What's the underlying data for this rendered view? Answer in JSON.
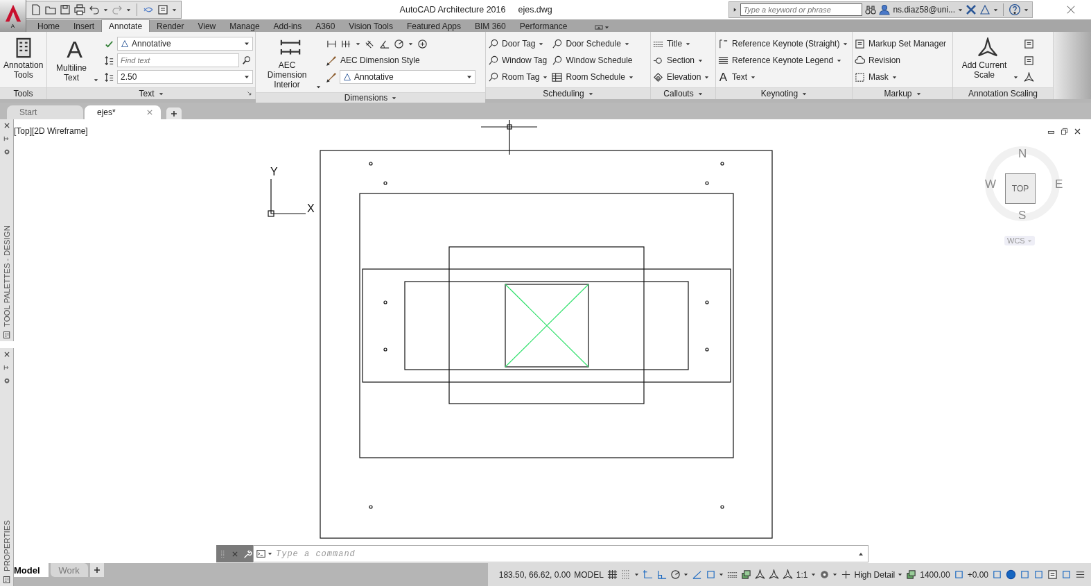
{
  "title_bar": {
    "app_letter": "A",
    "title": "AutoCAD Architecture 2016",
    "file": "ejes.dwg",
    "search_placeholder": "Type a keyword or phrase",
    "user": "ns.diaz58@uni..."
  },
  "ribbon_tabs": [
    {
      "label": "Home",
      "selected": false
    },
    {
      "label": "Insert",
      "selected": false
    },
    {
      "label": "Annotate",
      "selected": true
    },
    {
      "label": "Render",
      "selected": false
    },
    {
      "label": "View",
      "selected": false
    },
    {
      "label": "Manage",
      "selected": false
    },
    {
      "label": "Add-ins",
      "selected": false
    },
    {
      "label": "A360",
      "selected": false
    },
    {
      "label": "Vision Tools",
      "selected": false
    },
    {
      "label": "Featured Apps",
      "selected": false
    },
    {
      "label": "BIM 360",
      "selected": false
    },
    {
      "label": "Performance",
      "selected": false
    }
  ],
  "ribbon_panels": [
    {
      "title": "Tools",
      "menu": false,
      "launcher": false,
      "columns": [
        [
          {
            "kind": "large",
            "label": "Annotation Tools",
            "dropdown": false
          }
        ]
      ]
    },
    {
      "title": "Text",
      "menu": true,
      "launcher": true,
      "columns": [
        [
          {
            "kind": "large",
            "label": "Multiline Text",
            "glyph": "A",
            "dropdown": true
          }
        ],
        [
          {
            "kind": "style-combo",
            "value": "Annotative"
          },
          {
            "kind": "field",
            "placeholder": "Find text"
          },
          {
            "kind": "combo",
            "value": "2.50"
          }
        ]
      ]
    },
    {
      "title": "Dimensions",
      "menu": true,
      "launcher": false,
      "columns": [
        [
          {
            "kind": "large",
            "label": "AEC Dimension Interior",
            "dropdown": true
          }
        ],
        [
          {
            "kind": "toolrow"
          },
          {
            "kind": "small",
            "label": "AEC Dimension Style",
            "dropdown": false
          },
          {
            "kind": "style-combo",
            "value": "Annotative"
          }
        ]
      ]
    },
    {
      "title": "Scheduling",
      "menu": true,
      "launcher": false,
      "columns": [
        [
          {
            "kind": "small",
            "label": "Door Tag",
            "dropdown": true
          },
          {
            "kind": "small",
            "label": "Window Tag",
            "dropdown": false
          },
          {
            "kind": "small",
            "label": "Room Tag",
            "dropdown": true
          }
        ],
        [
          {
            "kind": "small",
            "label": "Door Schedule",
            "dropdown": true
          },
          {
            "kind": "small",
            "label": "Window Schedule",
            "dropdown": false
          },
          {
            "kind": "small",
            "label": "Room Schedule",
            "dropdown": true
          }
        ]
      ]
    },
    {
      "title": "Callouts",
      "menu": true,
      "launcher": false,
      "columns": [
        [
          {
            "kind": "small",
            "label": "Title",
            "dropdown": true
          },
          {
            "kind": "small",
            "label": "Section",
            "dropdown": true
          },
          {
            "kind": "small",
            "label": "Elevation",
            "dropdown": true
          }
        ]
      ]
    },
    {
      "title": "Keynoting",
      "menu": true,
      "launcher": false,
      "columns": [
        [
          {
            "kind": "small",
            "label": "Reference Keynote (Straight)",
            "dropdown": true
          },
          {
            "kind": "small",
            "label": "Reference Keynote Legend",
            "dropdown": true
          },
          {
            "kind": "small",
            "label": "Text",
            "glyph": "A",
            "dropdown": true
          }
        ]
      ]
    },
    {
      "title": "Markup",
      "menu": true,
      "launcher": false,
      "columns": [
        [
          {
            "kind": "small",
            "label": "Markup Set Manager",
            "dropdown": false
          },
          {
            "kind": "small",
            "label": "Revision",
            "dropdown": false
          },
          {
            "kind": "small",
            "label": "Mask",
            "dropdown": true
          }
        ]
      ]
    },
    {
      "title": "Annotation Scaling",
      "menu": false,
      "launcher": false,
      "columns": [
        [
          {
            "kind": "large",
            "label": "Add Current Scale",
            "dropdown": true
          }
        ],
        [
          {
            "kind": "iconbutton"
          },
          {
            "kind": "iconbutton"
          },
          {
            "kind": "iconbutton"
          }
        ]
      ]
    }
  ],
  "file_tabs": [
    {
      "label": "Start",
      "selected": false,
      "closable": false
    },
    {
      "label": "ejes*",
      "selected": true,
      "closable": true
    }
  ],
  "left_palettes": [
    {
      "label": "TOOL PALETTES - DESIGN"
    },
    {
      "label": "PROPERTIES"
    }
  ],
  "viewport": {
    "label": "[Top][2D Wireframe]",
    "axis_x": "X",
    "axis_y": "Y"
  },
  "viewcube": {
    "face": "TOP",
    "north": "N",
    "south": "S",
    "east": "E",
    "west": "W",
    "ucs": "WCS"
  },
  "command_line": {
    "placeholder": "Type a command"
  },
  "layout_tabs": [
    {
      "label": "Model",
      "selected": true
    },
    {
      "label": "Work",
      "selected": false
    }
  ],
  "status_items": [
    {
      "kind": "text",
      "label": "183.50, 66.62, 0.00",
      "dropdown": false
    },
    {
      "kind": "text",
      "label": "MODEL",
      "dropdown": false
    },
    {
      "kind": "icon",
      "dropdown": false
    },
    {
      "kind": "icon",
      "dropdown": true
    },
    {
      "kind": "icon",
      "dropdown": false
    },
    {
      "kind": "icon",
      "dropdown": false
    },
    {
      "kind": "icon",
      "dropdown": true
    },
    {
      "kind": "icon",
      "dropdown": false
    },
    {
      "kind": "icon",
      "dropdown": true
    },
    {
      "kind": "icon",
      "dropdown": false
    },
    {
      "kind": "icon",
      "dropdown": false
    },
    {
      "kind": "icon",
      "dropdown": false
    },
    {
      "kind": "icon",
      "dropdown": false
    },
    {
      "kind": "icon",
      "dropdown": false
    },
    {
      "kind": "text",
      "label": "1:1",
      "dropdown": true
    },
    {
      "kind": "icon",
      "dropdown": true
    },
    {
      "kind": "icon",
      "dropdown": false
    },
    {
      "kind": "text",
      "label": "High Detail",
      "dropdown": true
    },
    {
      "kind": "icon",
      "dropdown": false
    },
    {
      "kind": "text",
      "label": "1400.00",
      "dropdown": false
    },
    {
      "kind": "icon",
      "dropdown": false
    },
    {
      "kind": "text",
      "label": "+0.00",
      "dropdown": false
    },
    {
      "kind": "icon",
      "dropdown": false
    },
    {
      "kind": "icon",
      "dropdown": false
    },
    {
      "kind": "icon",
      "dropdown": false
    },
    {
      "kind": "icon",
      "dropdown": false
    },
    {
      "kind": "icon",
      "dropdown": false
    },
    {
      "kind": "icon",
      "dropdown": false
    },
    {
      "kind": "icon",
      "dropdown": false
    }
  ]
}
